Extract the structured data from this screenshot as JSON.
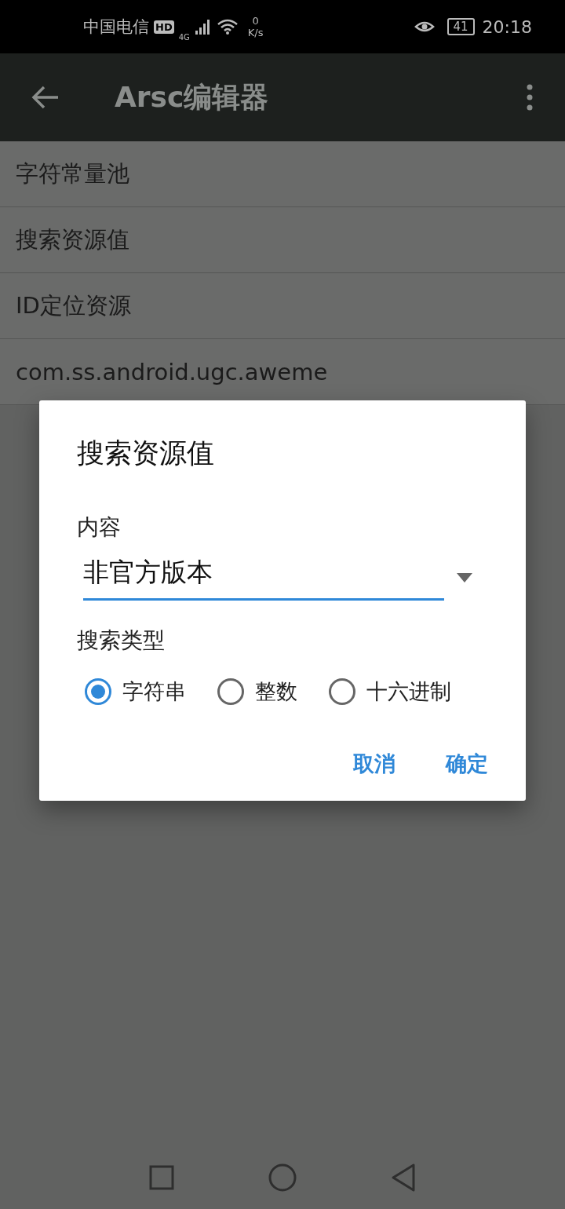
{
  "status_bar": {
    "carrier": "中国电信",
    "network_badge": "HD",
    "network_type": "4G",
    "speed_value": "0",
    "speed_unit": "K/s",
    "battery": "41",
    "time": "20:18"
  },
  "app_bar": {
    "title": "Arsc编辑器"
  },
  "list": [
    {
      "label": "字符常量池"
    },
    {
      "label": "搜索资源值"
    },
    {
      "label": "ID定位资源"
    },
    {
      "label": "com.ss.android.ugc.aweme"
    }
  ],
  "dialog": {
    "title": "搜索资源值",
    "content_label": "内容",
    "content_value": "非官方版本",
    "search_type_label": "搜索类型",
    "options": [
      {
        "label": "字符串",
        "selected": true
      },
      {
        "label": "整数",
        "selected": false
      },
      {
        "label": "十六进制",
        "selected": false
      }
    ],
    "buttons": [
      {
        "label": "取消"
      },
      {
        "label": "确定"
      }
    ]
  }
}
